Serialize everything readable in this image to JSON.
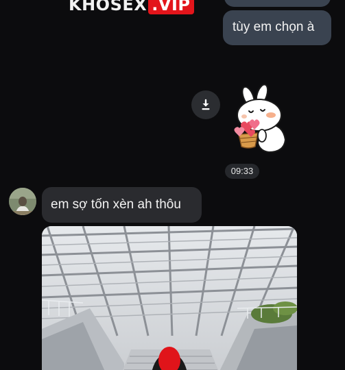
{
  "watermark": {
    "left_text": "KHOSEX",
    "right_text": ".VIP"
  },
  "messages": {
    "outgoing_text": "tùy em chọn à",
    "time": "09:33",
    "incoming_text": "em sợ tốn xèn ah thôu"
  },
  "icons": {
    "download": "download-icon",
    "sticker": "rabbit-with-hearts-sticker",
    "avatar": "contact-avatar"
  },
  "colors": {
    "background": "#0c0c0e",
    "outgoing_bubble": "#3a4350",
    "incoming_bubble": "#2a2b2f",
    "watermark_red": "#e3151b"
  }
}
